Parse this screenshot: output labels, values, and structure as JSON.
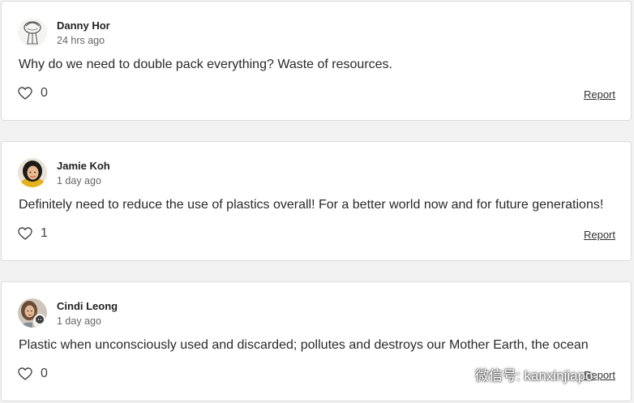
{
  "comments": [
    {
      "author": "Danny Hor",
      "time": "24 hrs ago",
      "text": "Why do we need to double pack everything? Waste of resources.",
      "likes": "0",
      "report_label": "Report",
      "avatar_icon": "sketch-avatar"
    },
    {
      "author": "Jamie Koh",
      "time": "1 day ago",
      "text": "Definitely need to reduce the use of plastics overall! For a better world now and for future generations!",
      "likes": "1",
      "report_label": "Report",
      "avatar_icon": "photo-avatar"
    },
    {
      "author": "Cindi Leong",
      "time": "1 day ago",
      "text": "Plastic when unconsciously used and discarded; pollutes and destroys our Mother Earth, the ocean",
      "likes": "0",
      "report_label": "Report",
      "avatar_icon": "photo-avatar-with-dog"
    }
  ],
  "watermark": {
    "text": "微信号: kanxinjiapo",
    "icon": "wechat-logo"
  },
  "colors": {
    "background": "#f2f2f2",
    "card": "#ffffff",
    "border": "#dcdcdc"
  }
}
